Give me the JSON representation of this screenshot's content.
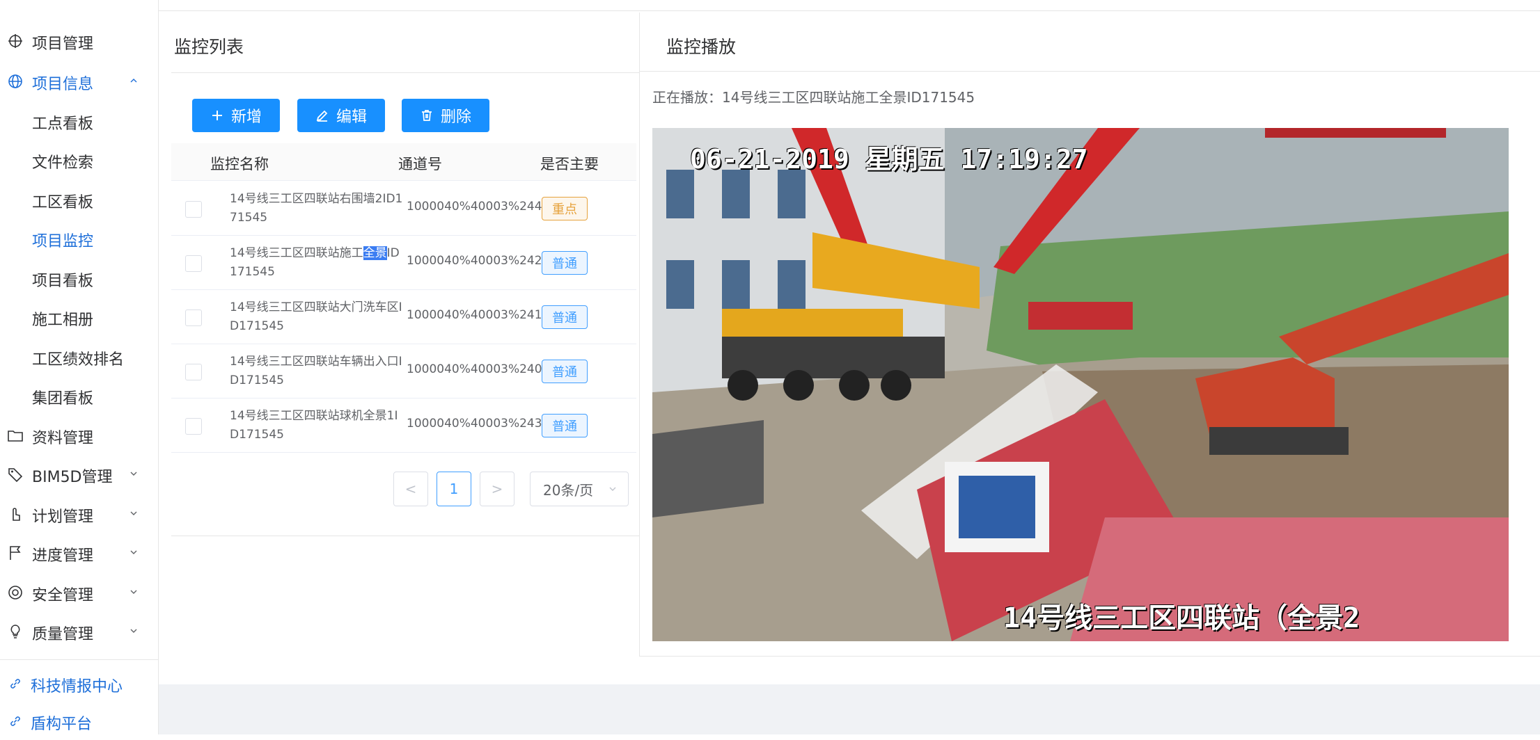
{
  "sidebar": {
    "items": [
      {
        "label": "项目管理"
      },
      {
        "label": "项目信息"
      },
      {
        "label": "工点看板"
      },
      {
        "label": "文件检索"
      },
      {
        "label": "工区看板"
      },
      {
        "label": "项目监控"
      },
      {
        "label": "项目看板"
      },
      {
        "label": "施工相册"
      },
      {
        "label": "工区绩效排名"
      },
      {
        "label": "集团看板"
      },
      {
        "label": "资料管理"
      },
      {
        "label": "BIM5D管理"
      },
      {
        "label": "计划管理"
      },
      {
        "label": "进度管理"
      },
      {
        "label": "安全管理"
      },
      {
        "label": "质量管理"
      }
    ],
    "links": [
      {
        "label": "科技情报中心"
      },
      {
        "label": "盾构平台"
      }
    ]
  },
  "list_panel": {
    "title": "监控列表",
    "buttons": {
      "add": "新增",
      "edit": "编辑",
      "delete": "删除"
    },
    "columns": {
      "name": "监控名称",
      "channel": "通道号",
      "primary": "是否主要"
    },
    "rows": [
      {
        "name": "14号线三工区四联站右围墙2ID171545",
        "channel": "1000040%40003%244",
        "tag": "重点"
      },
      {
        "name_a": "14号线三工区四联站施工",
        "name_sel": "全景",
        "name_b": "ID171545",
        "channel": "1000040%40003%242",
        "tag": "普通"
      },
      {
        "name": "14号线三工区四联站大门洗车区ID171545",
        "channel": "1000040%40003%241",
        "tag": "普通"
      },
      {
        "name": "14号线三工区四联站车辆出入口ID171545",
        "channel": "1000040%40003%240",
        "tag": "普通"
      },
      {
        "name": "14号线三工区四联站球机全景1ID171545",
        "channel": "1000040%40003%243",
        "tag": "普通"
      }
    ],
    "pagination": {
      "prev": "<",
      "current": "1",
      "next": ">",
      "page_size": "20条/页"
    }
  },
  "play_panel": {
    "title": "监控播放",
    "now_playing": "正在播放：14号线三工区四联站施工全景ID171545",
    "video": {
      "osd_time": "06-21-2019 星期五 17:19:27",
      "osd_name": "14号线三工区四联站（全景2"
    }
  },
  "colors": {
    "accent": "#1890ff",
    "active": "#1e6fd9",
    "tag_main": "#e6a23c",
    "tag_normal": "#409eff"
  }
}
